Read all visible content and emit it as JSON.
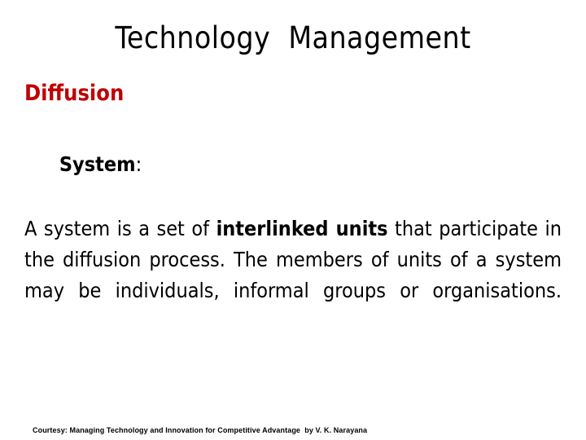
{
  "slide": {
    "title": "Technology  Management",
    "background_color": "#FFFFFF",
    "heading": {
      "text": "Diffusion",
      "color": "#C00000"
    },
    "term": {
      "label": "System",
      "separator": ":"
    },
    "definition": {
      "part1": "A system is a set of ",
      "emphasis": "interlinked units",
      "part2": " that participate in the diffusion process. The members of units of a system may be individuals, informal groups or organisations.",
      "full_text": "A system is a set of interlinked units that participate in the diffusion process. The members of units of a system may be individuals, informal groups or organisations.",
      "lines": [
        "A  system  is  a  set  of  interlinked  units  that",
        "participate in the diffusion process. The members",
        "of units of a system may be individuals, informal",
        "groups or organisations."
      ]
    },
    "footer": {
      "courtesy": "Courtesy: Managing Technology and Innovation for Competitive Advantage  by V. K. Narayana"
    }
  }
}
